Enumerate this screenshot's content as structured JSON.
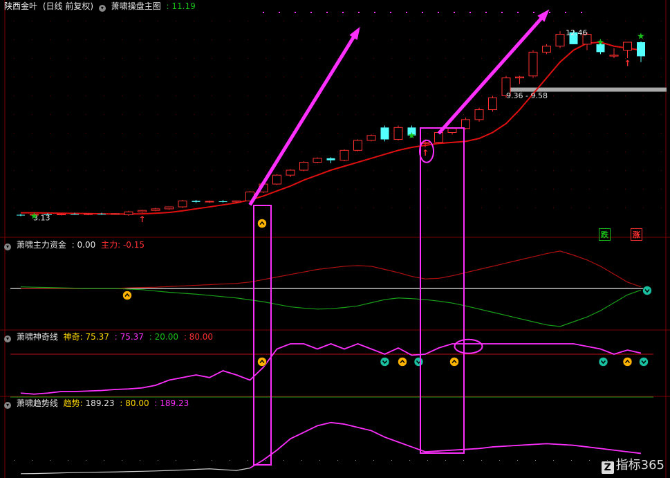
{
  "panels": {
    "main": {
      "stock": "陕西金叶",
      "period": "(日线 前复权)",
      "indicator": "萧啸操盘主图",
      "value": ": 11.19",
      "hi_label": "12.46",
      "lo_label": "3.13",
      "band_label": "9.36 - 9.58",
      "sell_tag": "跌",
      "buy_tag": "涨"
    },
    "fund": {
      "name": "萧啸主力资金",
      "value": ": 0.00",
      "main_label": "主力:",
      "main_value": "-0.15"
    },
    "magic": {
      "name": "萧啸神奇线",
      "label": "神奇:",
      "v1": "75.37",
      "v2": ": 75.37",
      "v3": ": 20.00",
      "v4": ": 80.00"
    },
    "trend": {
      "name": "萧啸趋势线",
      "label": "趋势:",
      "v1": "189.23",
      "v2": ": 80.00",
      "v3": ": 189.23"
    }
  },
  "watermark": "指标365",
  "colors": {
    "up": "#ff3030",
    "down": "#54ffff",
    "ma": "#e01010",
    "magenta": "#ff30ff",
    "green": "#19c019",
    "yellow": "#ffd700",
    "frame": "#7a0000"
  },
  "chart_data": [
    {
      "type": "candlestick",
      "title": "萧啸操盘主图",
      "ylim": [
        2.8,
        13.4
      ],
      "x": [
        1,
        2,
        3,
        4,
        5,
        6,
        7,
        8,
        9,
        10,
        11,
        12,
        13,
        14,
        15,
        16,
        17,
        18,
        19,
        20,
        21,
        22,
        23,
        24,
        25,
        26,
        27,
        28,
        29,
        30,
        31,
        32,
        33,
        34,
        35,
        36,
        37,
        38,
        39,
        40,
        41,
        42,
        43,
        44,
        45,
        46,
        47
      ],
      "ohlc": [
        [
          3.2,
          3.25,
          3.13,
          3.18
        ],
        [
          3.2,
          3.26,
          3.15,
          3.22
        ],
        [
          3.22,
          3.28,
          3.18,
          3.2
        ],
        [
          3.2,
          3.27,
          3.17,
          3.24
        ],
        [
          3.24,
          3.3,
          3.2,
          3.22
        ],
        [
          3.22,
          3.28,
          3.18,
          3.25
        ],
        [
          3.25,
          3.3,
          3.2,
          3.23
        ],
        [
          3.23,
          3.29,
          3.2,
          3.26
        ],
        [
          3.2,
          3.4,
          3.15,
          3.35
        ],
        [
          3.35,
          3.45,
          3.3,
          3.42
        ],
        [
          3.42,
          3.55,
          3.38,
          3.5
        ],
        [
          3.5,
          3.62,
          3.45,
          3.6
        ],
        [
          3.6,
          3.95,
          3.55,
          3.9
        ],
        [
          3.9,
          3.95,
          3.8,
          3.85
        ],
        [
          3.85,
          3.92,
          3.8,
          3.88
        ],
        [
          3.88,
          3.95,
          3.82,
          3.85
        ],
        [
          3.85,
          3.92,
          3.8,
          3.9
        ],
        [
          3.9,
          4.4,
          3.85,
          4.35
        ],
        [
          4.35,
          4.8,
          4.3,
          4.75
        ],
        [
          4.75,
          5.25,
          4.7,
          5.2
        ],
        [
          5.2,
          5.5,
          5.1,
          5.45
        ],
        [
          5.45,
          5.9,
          5.4,
          5.85
        ],
        [
          5.85,
          6.1,
          5.8,
          6.05
        ],
        [
          6.05,
          6.1,
          5.8,
          5.95
        ],
        [
          5.95,
          6.5,
          5.9,
          6.45
        ],
        [
          6.45,
          7.0,
          6.4,
          6.95
        ],
        [
          6.95,
          7.25,
          6.9,
          7.2
        ],
        [
          7.6,
          7.7,
          6.9,
          7.0
        ],
        [
          7.0,
          7.7,
          6.95,
          7.6
        ],
        [
          7.6,
          7.7,
          7.1,
          7.2
        ],
        [
          6.8,
          7.0,
          6.6,
          6.85
        ],
        [
          6.85,
          7.4,
          6.8,
          7.35
        ],
        [
          7.35,
          7.6,
          7.25,
          7.55
        ],
        [
          7.55,
          8.1,
          7.5,
          8.0
        ],
        [
          8.0,
          8.6,
          7.9,
          8.5
        ],
        [
          8.5,
          9.2,
          8.4,
          9.1
        ],
        [
          9.2,
          10.2,
          9.1,
          10.1
        ],
        [
          10.1,
          10.2,
          9.8,
          10.15
        ],
        [
          10.2,
          11.5,
          10.1,
          11.4
        ],
        [
          11.4,
          11.8,
          11.3,
          11.7
        ],
        [
          11.7,
          12.46,
          11.6,
          12.3
        ],
        [
          12.4,
          12.5,
          11.8,
          11.8
        ],
        [
          11.8,
          12.4,
          11.5,
          12.3
        ],
        [
          11.8,
          11.9,
          11.3,
          11.4
        ],
        [
          11.2,
          11.6,
          11.1,
          11.25
        ],
        [
          11.5,
          11.9,
          11.1,
          11.9
        ],
        [
          11.9,
          11.95,
          10.9,
          11.19
        ]
      ],
      "ma": [
        3.3,
        3.3,
        3.29,
        3.28,
        3.27,
        3.26,
        3.25,
        3.24,
        3.24,
        3.25,
        3.28,
        3.32,
        3.4,
        3.5,
        3.6,
        3.7,
        3.8,
        3.95,
        4.15,
        4.4,
        4.65,
        4.95,
        5.2,
        5.45,
        5.65,
        5.85,
        6.05,
        6.25,
        6.45,
        6.6,
        6.7,
        6.8,
        6.85,
        6.9,
        7.05,
        7.35,
        7.8,
        8.5,
        9.3,
        10.1,
        10.9,
        11.5,
        11.85,
        11.9,
        11.7,
        11.6,
        11.5
      ],
      "arrows": [
        [
          18,
          3.7,
          12.5
        ],
        [
          32,
          7.3,
          13.4
        ]
      ],
      "gray_band": [
        9.36,
        9.58
      ]
    },
    {
      "type": "line",
      "title": "萧啸主力资金",
      "ylim": [
        -1.2,
        1.2
      ],
      "series": [
        {
          "name": "主力",
          "values": [
            0,
            0,
            0,
            0,
            0,
            0,
            0,
            0,
            0.02,
            0.03,
            0.04,
            0.06,
            0.08,
            0.1,
            0.12,
            0.14,
            0.16,
            0.2,
            0.28,
            0.36,
            0.44,
            0.52,
            0.6,
            0.65,
            0.7,
            0.72,
            0.7,
            0.6,
            0.5,
            0.38,
            0.3,
            0.32,
            0.4,
            0.5,
            0.6,
            0.7,
            0.8,
            0.9,
            1.0,
            1.1,
            1.18,
            1.05,
            0.9,
            0.7,
            0.45,
            0.2,
            0.05
          ]
        },
        {
          "name": "",
          "values": [
            0.05,
            0.04,
            0.03,
            0.02,
            0.01,
            0,
            0,
            0,
            -0.02,
            -0.04,
            -0.08,
            -0.12,
            -0.15,
            -0.18,
            -0.22,
            -0.26,
            -0.3,
            -0.36,
            -0.42,
            -0.5,
            -0.58,
            -0.62,
            -0.65,
            -0.64,
            -0.6,
            -0.55,
            -0.45,
            -0.35,
            -0.3,
            -0.32,
            -0.35,
            -0.4,
            -0.46,
            -0.55,
            -0.65,
            -0.75,
            -0.85,
            -0.95,
            -1.05,
            -1.15,
            -1.2,
            -1.05,
            -0.9,
            -0.7,
            -0.45,
            -0.2,
            -0.05
          ]
        }
      ]
    },
    {
      "type": "line",
      "title": "萧啸神奇线",
      "ylim": [
        0,
        100
      ],
      "levels": [
        20,
        80
      ],
      "series": [
        {
          "name": "神奇",
          "values": [
            5,
            3,
            5,
            8,
            8,
            9,
            10,
            12,
            13,
            15,
            20,
            30,
            35,
            40,
            35,
            48,
            40,
            30,
            55,
            90,
            100,
            100,
            90,
            100,
            90,
            100,
            90,
            80,
            92,
            78,
            80,
            92,
            100,
            100,
            100,
            100,
            100,
            100,
            100,
            100,
            100,
            100,
            95,
            90,
            80,
            88,
            82
          ]
        }
      ]
    },
    {
      "type": "line",
      "title": "萧啸趋势线",
      "ylim": [
        0,
        400
      ],
      "series": [
        {
          "name": "趋势",
          "values": [
            5,
            6,
            8,
            10,
            12,
            14,
            15,
            16,
            18,
            20,
            22,
            25,
            28,
            32,
            35,
            30,
            25,
            40,
            90,
            150,
            220,
            260,
            300,
            320,
            310,
            290,
            270,
            230,
            200,
            170,
            140,
            145,
            150,
            155,
            160,
            170,
            175,
            180,
            185,
            190,
            185,
            180,
            170,
            160,
            150,
            140,
            130
          ]
        }
      ]
    }
  ]
}
